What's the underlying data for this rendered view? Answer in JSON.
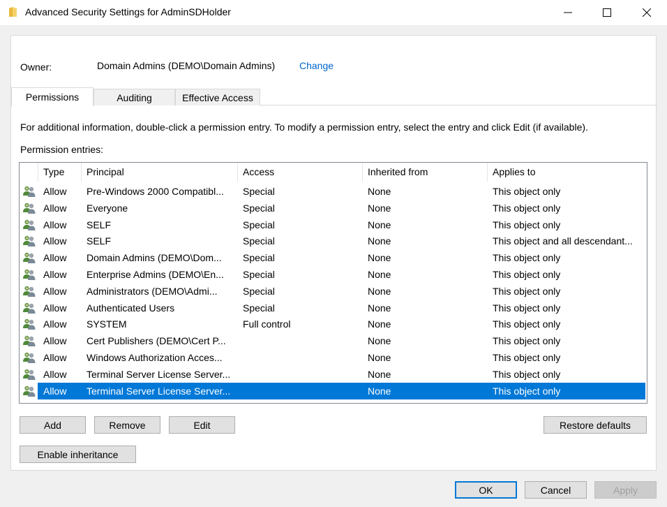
{
  "window": {
    "title": "Advanced Security Settings for AdminSDHolder"
  },
  "owner": {
    "label": "Owner:",
    "value": "Domain Admins (DEMO\\Domain Admins)",
    "change_link": "Change"
  },
  "tabs": [
    {
      "label": "Permissions",
      "active": true
    },
    {
      "label": "Auditing",
      "active": false
    },
    {
      "label": "Effective Access",
      "active": false
    }
  ],
  "info_text": "For additional information, double-click a permission entry. To modify a permission entry, select the entry and click Edit (if available).",
  "entries_label": "Permission entries:",
  "columns": [
    "Type",
    "Principal",
    "Access",
    "Inherited from",
    "Applies to"
  ],
  "rows": [
    {
      "type": "Allow",
      "principal": "Pre-Windows 2000 Compatibl...",
      "access": "Special",
      "inherited": "None",
      "applies": "This object only"
    },
    {
      "type": "Allow",
      "principal": "Everyone",
      "access": "Special",
      "inherited": "None",
      "applies": "This object only"
    },
    {
      "type": "Allow",
      "principal": "SELF",
      "access": "Special",
      "inherited": "None",
      "applies": "This object only"
    },
    {
      "type": "Allow",
      "principal": "SELF",
      "access": "Special",
      "inherited": "None",
      "applies": "This object and all descendant..."
    },
    {
      "type": "Allow",
      "principal": "Domain Admins (DEMO\\Dom...",
      "access": "Special",
      "inherited": "None",
      "applies": "This object only"
    },
    {
      "type": "Allow",
      "principal": "Enterprise Admins (DEMO\\En...",
      "access": "Special",
      "inherited": "None",
      "applies": "This object only"
    },
    {
      "type": "Allow",
      "principal": "Administrators (DEMO\\Admi...",
      "access": "Special",
      "inherited": "None",
      "applies": "This object only"
    },
    {
      "type": "Allow",
      "principal": "Authenticated Users",
      "access": "Special",
      "inherited": "None",
      "applies": "This object only"
    },
    {
      "type": "Allow",
      "principal": "SYSTEM",
      "access": "Full control",
      "inherited": "None",
      "applies": "This object only"
    },
    {
      "type": "Allow",
      "principal": "Cert Publishers (DEMO\\Cert P...",
      "access": "",
      "inherited": "None",
      "applies": "This object only"
    },
    {
      "type": "Allow",
      "principal": "Windows Authorization Acces...",
      "access": "",
      "inherited": "None",
      "applies": "This object only"
    },
    {
      "type": "Allow",
      "principal": "Terminal Server License Server...",
      "access": "",
      "inherited": "None",
      "applies": "This object only"
    },
    {
      "type": "Allow",
      "principal": "Terminal Server License Server...",
      "access": "",
      "inherited": "None",
      "applies": "This object only",
      "selected": true
    }
  ],
  "buttons": {
    "add": "Add",
    "remove": "Remove",
    "edit": "Edit",
    "restore_defaults": "Restore defaults",
    "enable_inheritance": "Enable inheritance",
    "ok": "OK",
    "cancel": "Cancel",
    "apply": "Apply"
  },
  "colors": {
    "selection": "#0078d7",
    "link": "#0066cc"
  }
}
